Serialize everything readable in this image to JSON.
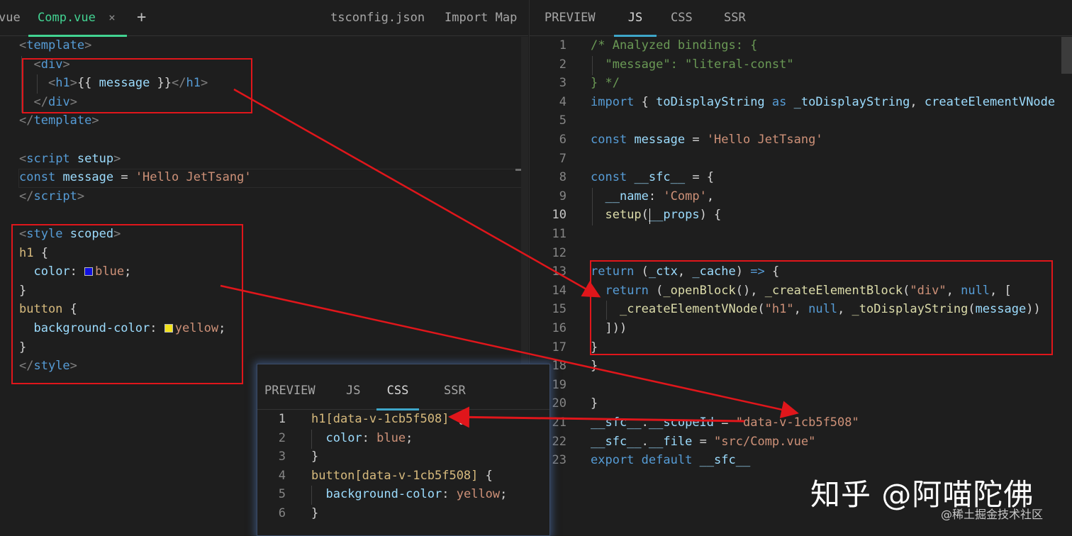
{
  "left_tabs": {
    "partial_tab": "vue",
    "active_tab": "Comp.vue",
    "close_glyph": "×",
    "add_glyph": "+",
    "tsconfig": "tsconfig.json",
    "import_map": "Import Map"
  },
  "right_tabs": [
    "PREVIEW",
    "JS",
    "CSS",
    "SSR"
  ],
  "popup_tabs": [
    "PREVIEW",
    "JS",
    "CSS",
    "SSR"
  ],
  "active_colors": {
    "accent": "#42d392",
    "annotation_red": "#e0161b"
  },
  "left_code": [
    [
      [
        "t-tag",
        "<"
      ],
      [
        "t-name",
        "template"
      ],
      [
        "t-tag",
        ">"
      ]
    ],
    [
      [
        "t-txt",
        "  "
      ],
      [
        "t-tag",
        "<"
      ],
      [
        "t-name",
        "div"
      ],
      [
        "t-tag",
        ">"
      ]
    ],
    [
      [
        "t-txt",
        "    "
      ],
      [
        "t-tag",
        "<"
      ],
      [
        "t-name",
        "h1"
      ],
      [
        "t-tag",
        ">"
      ],
      [
        "t-txt",
        "{{ "
      ],
      [
        "t-var",
        "message"
      ],
      [
        "t-txt",
        " }}"
      ],
      [
        "t-tag",
        "</"
      ],
      [
        "t-name",
        "h1"
      ],
      [
        "t-tag",
        ">"
      ]
    ],
    [
      [
        "t-txt",
        "  "
      ],
      [
        "t-tag",
        "</"
      ],
      [
        "t-name",
        "div"
      ],
      [
        "t-tag",
        ">"
      ]
    ],
    [
      [
        "t-tag",
        "</"
      ],
      [
        "t-name",
        "template"
      ],
      [
        "t-tag",
        ">"
      ]
    ],
    [],
    [
      [
        "t-tag",
        "<"
      ],
      [
        "t-name",
        "script"
      ],
      [
        "t-txt",
        " "
      ],
      [
        "t-attr",
        "setup"
      ],
      [
        "t-tag",
        ">"
      ]
    ],
    [
      [
        "t-kw",
        "const"
      ],
      [
        "t-txt",
        " "
      ],
      [
        "t-var",
        "message"
      ],
      [
        "t-txt",
        " = "
      ],
      [
        "t-str",
        "'Hello JetTsang'"
      ]
    ],
    [
      [
        "t-tag",
        "</"
      ],
      [
        "t-name",
        "script"
      ],
      [
        "t-tag",
        ">"
      ]
    ],
    [],
    [
      [
        "t-tag",
        "<"
      ],
      [
        "t-name",
        "style"
      ],
      [
        "t-txt",
        " "
      ],
      [
        "t-attr",
        "scoped"
      ],
      [
        "t-tag",
        ">"
      ]
    ],
    [
      [
        "t-sel",
        "h1"
      ],
      [
        "t-txt",
        " {"
      ]
    ],
    [
      [
        "t-txt",
        "  "
      ],
      [
        "t-prop",
        "color"
      ],
      [
        "t-txt",
        ": "
      ],
      [
        "swatch",
        "#1010e0"
      ],
      [
        "t-val",
        "blue"
      ],
      [
        "t-txt",
        ";"
      ]
    ],
    [
      [
        "t-txt",
        "}"
      ]
    ],
    [
      [
        "t-sel",
        "button"
      ],
      [
        "t-txt",
        " {"
      ]
    ],
    [
      [
        "t-txt",
        "  "
      ],
      [
        "t-prop",
        "background-color"
      ],
      [
        "t-txt",
        ": "
      ],
      [
        "swatch",
        "#f2e21c"
      ],
      [
        "t-val",
        "yellow"
      ],
      [
        "t-txt",
        ";"
      ]
    ],
    [
      [
        "t-txt",
        "}"
      ]
    ],
    [
      [
        "t-tag",
        "</"
      ],
      [
        "t-name",
        "style"
      ],
      [
        "t-tag",
        ">"
      ]
    ]
  ],
  "right_line_numbers": [
    "1",
    "2",
    "3",
    "4",
    "5",
    "6",
    "7",
    "8",
    "9",
    "10",
    "11",
    "12",
    "13",
    "14",
    "15",
    "16",
    "17",
    "18",
    "19",
    "20",
    "21",
    "22",
    "23"
  ],
  "right_code": [
    [
      [
        "t-cmt",
        "/* Analyzed bindings: {"
      ]
    ],
    [
      [
        "t-cmt",
        "  \"message\": \"literal-const\""
      ]
    ],
    [
      [
        "t-cmt",
        "} */"
      ]
    ],
    [
      [
        "t-kw",
        "import"
      ],
      [
        "t-txt",
        " { "
      ],
      [
        "t-var",
        "toDisplayString"
      ],
      [
        "t-txt",
        " "
      ],
      [
        "t-kw",
        "as"
      ],
      [
        "t-txt",
        " "
      ],
      [
        "t-var",
        "_toDisplayString"
      ],
      [
        "t-txt",
        ", "
      ],
      [
        "t-var",
        "createElementVNode"
      ]
    ],
    [],
    [
      [
        "t-kw",
        "const"
      ],
      [
        "t-txt",
        " "
      ],
      [
        "t-var",
        "message"
      ],
      [
        "t-txt",
        " = "
      ],
      [
        "t-str",
        "'Hello JetTsang'"
      ]
    ],
    [],
    [
      [
        "t-kw",
        "const"
      ],
      [
        "t-txt",
        " "
      ],
      [
        "t-var",
        "__sfc__"
      ],
      [
        "t-txt",
        " = {"
      ]
    ],
    [
      [
        "t-txt",
        "  "
      ],
      [
        "t-var",
        "__name"
      ],
      [
        "t-txt",
        ": "
      ],
      [
        "t-str",
        "'Comp'"
      ],
      [
        "t-txt",
        ","
      ]
    ],
    [
      [
        "t-txt",
        "  "
      ],
      [
        "t-fn",
        "setup"
      ],
      [
        "t-txt",
        "("
      ],
      [
        "t-var",
        "__props"
      ],
      [
        "t-txt",
        ") {"
      ]
    ],
    [],
    [],
    [
      [
        "t-kw",
        "return"
      ],
      [
        "t-txt",
        " ("
      ],
      [
        "t-var",
        "_ctx"
      ],
      [
        "t-txt",
        ", "
      ],
      [
        "t-var",
        "_cache"
      ],
      [
        "t-txt",
        ") "
      ],
      [
        "t-kw",
        "=>"
      ],
      [
        "t-txt",
        " {"
      ]
    ],
    [
      [
        "t-txt",
        "  "
      ],
      [
        "t-kw",
        "return"
      ],
      [
        "t-txt",
        " ("
      ],
      [
        "t-fn",
        "_openBlock"
      ],
      [
        "t-txt",
        "(), "
      ],
      [
        "t-fn",
        "_createElementBlock"
      ],
      [
        "t-txt",
        "("
      ],
      [
        "t-str",
        "\"div\""
      ],
      [
        "t-txt",
        ", "
      ],
      [
        "t-num",
        "null"
      ],
      [
        "t-txt",
        ", ["
      ]
    ],
    [
      [
        "t-txt",
        "    "
      ],
      [
        "t-fn",
        "_createElementVNode"
      ],
      [
        "t-txt",
        "("
      ],
      [
        "t-str",
        "\"h1\""
      ],
      [
        "t-txt",
        ", "
      ],
      [
        "t-num",
        "null"
      ],
      [
        "t-txt",
        ", "
      ],
      [
        "t-fn",
        "_toDisplayString"
      ],
      [
        "t-txt",
        "("
      ],
      [
        "t-var",
        "message"
      ],
      [
        "t-txt",
        "))"
      ]
    ],
    [
      [
        "t-txt",
        "  ]))"
      ]
    ],
    [
      [
        "t-txt",
        "}"
      ]
    ],
    [
      [
        "t-txt",
        "}"
      ]
    ],
    [],
    [
      [
        "t-txt",
        "}"
      ]
    ],
    [
      [
        "t-var",
        "__sfc__"
      ],
      [
        "t-txt",
        "."
      ],
      [
        "t-var",
        "__scopeId"
      ],
      [
        "t-txt",
        " = "
      ],
      [
        "t-str",
        "\"data-v-1cb5f508\""
      ]
    ],
    [
      [
        "t-var",
        "__sfc__"
      ],
      [
        "t-txt",
        "."
      ],
      [
        "t-var",
        "__file"
      ],
      [
        "t-txt",
        " = "
      ],
      [
        "t-str",
        "\"src/Comp.vue\""
      ]
    ],
    [
      [
        "t-kw",
        "export"
      ],
      [
        "t-txt",
        " "
      ],
      [
        "t-kw",
        "default"
      ],
      [
        "t-txt",
        " "
      ],
      [
        "t-var",
        "__sfc__"
      ]
    ]
  ],
  "popup_line_numbers": [
    "1",
    "2",
    "3",
    "4",
    "5",
    "6"
  ],
  "popup_code": [
    [
      [
        "t-sel",
        "h1[data-v-1cb5f508]"
      ],
      [
        "t-txt",
        " {"
      ]
    ],
    [
      [
        "t-txt",
        "  "
      ],
      [
        "t-prop",
        "color"
      ],
      [
        "t-txt",
        ": "
      ],
      [
        "t-val",
        "blue"
      ],
      [
        "t-txt",
        ";"
      ]
    ],
    [
      [
        "t-txt",
        "}"
      ]
    ],
    [
      [
        "t-sel",
        "button[data-v-1cb5f508]"
      ],
      [
        "t-txt",
        " {"
      ]
    ],
    [
      [
        "t-txt",
        "  "
      ],
      [
        "t-prop",
        "background-color"
      ],
      [
        "t-txt",
        ": "
      ],
      [
        "t-val",
        "yellow"
      ],
      [
        "t-txt",
        ";"
      ]
    ],
    [
      [
        "t-txt",
        "}"
      ]
    ]
  ],
  "watermark": {
    "main": "知乎 @阿喵陀佛",
    "sub": "@稀土掘金技术社区"
  }
}
